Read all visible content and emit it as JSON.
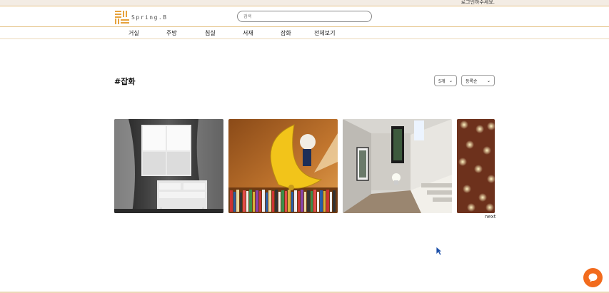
{
  "topbar": {
    "login_text": "로그인하주세요."
  },
  "header": {
    "logo_text": "Spring.B",
    "search_placeholder": "검색"
  },
  "nav": {
    "items": [
      "거실",
      "주방",
      "침실",
      "서재",
      "잡화",
      "전체보기"
    ]
  },
  "main": {
    "title": "#잡화",
    "count_select": "5개",
    "sort_select": "등록순",
    "next_label": "next",
    "products": [
      {
        "icon": "window-dresser-photo"
      },
      {
        "icon": "moon-lamp-photo"
      },
      {
        "icon": "hallway-photo"
      },
      {
        "icon": "string-lights-photo"
      }
    ]
  },
  "colors": {
    "accent": "#e6c48a",
    "chat": "#f26b1d",
    "topbar": "#f3ece4"
  }
}
